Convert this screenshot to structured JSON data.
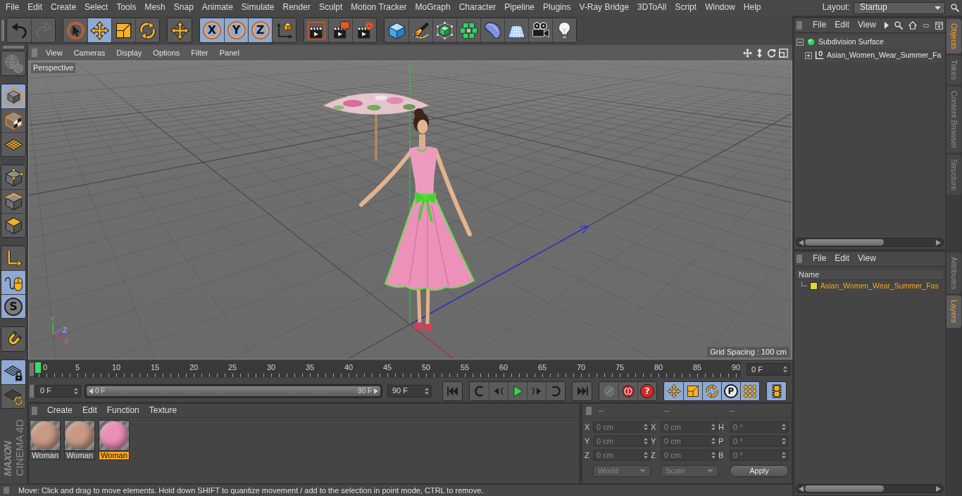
{
  "menu_bar": {
    "items": [
      "File",
      "Edit",
      "Create",
      "Select",
      "Tools",
      "Mesh",
      "Snap",
      "Animate",
      "Simulate",
      "Render",
      "Sculpt",
      "Motion Tracker",
      "MoGraph",
      "Character",
      "Pipeline",
      "Plugins",
      "V-Ray Bridge",
      "3DToAll",
      "Script",
      "Window",
      "Help"
    ],
    "layout_label": "Layout:",
    "layout_value": "Startup"
  },
  "toolbar": {
    "groups": [
      {
        "items": [
          {
            "kind": "undo",
            "selected": false,
            "disabled": false
          },
          {
            "kind": "redo",
            "selected": false,
            "disabled": true
          }
        ]
      },
      {
        "items": [
          {
            "kind": "select",
            "selected": false,
            "disabled": false
          },
          {
            "kind": "move",
            "selected": true,
            "disabled": false
          },
          {
            "kind": "scale",
            "selected": false,
            "disabled": false
          },
          {
            "kind": "rotate",
            "selected": false,
            "disabled": false
          }
        ]
      },
      {
        "items": [
          {
            "kind": "recent",
            "selected": false,
            "disabled": false
          }
        ]
      },
      {
        "items": [
          {
            "kind": "axis",
            "label": "X",
            "selected": true,
            "disabled": false
          },
          {
            "kind": "axis",
            "label": "Y",
            "selected": true,
            "disabled": false
          },
          {
            "kind": "axis",
            "label": "Z",
            "selected": true,
            "disabled": false
          },
          {
            "kind": "coords",
            "selected": false,
            "disabled": false
          }
        ]
      },
      {
        "items": [
          {
            "kind": "renderview",
            "selected": false,
            "disabled": false
          },
          {
            "kind": "renderpicture",
            "selected": false,
            "disabled": false
          },
          {
            "kind": "rendersettings",
            "selected": false,
            "disabled": false
          }
        ]
      },
      {
        "items": [
          {
            "kind": "cube",
            "selected": false,
            "disabled": false
          },
          {
            "kind": "pen",
            "selected": false,
            "disabled": false
          },
          {
            "kind": "subdivision",
            "selected": false,
            "disabled": false
          },
          {
            "kind": "cloner",
            "selected": false,
            "disabled": false
          },
          {
            "kind": "deformer",
            "selected": false,
            "disabled": false
          },
          {
            "kind": "floor",
            "selected": false,
            "disabled": false
          },
          {
            "kind": "camera",
            "selected": false,
            "disabled": false
          },
          {
            "kind": "light",
            "selected": false,
            "disabled": false
          }
        ]
      }
    ]
  },
  "left_toolbar": {
    "groups": [
      {
        "items": [
          {
            "kind": "editable",
            "selected": false,
            "disabled": true
          }
        ]
      },
      {
        "items": [
          {
            "kind": "model",
            "selected": true,
            "disabled": false
          },
          {
            "kind": "texture",
            "selected": false,
            "disabled": false
          },
          {
            "kind": "workplane",
            "selected": false,
            "disabled": false
          }
        ]
      },
      {
        "items": [
          {
            "kind": "points",
            "selected": false,
            "disabled": false
          },
          {
            "kind": "edges",
            "selected": false,
            "disabled": false
          },
          {
            "kind": "polygons",
            "selected": false,
            "disabled": false
          }
        ]
      },
      {
        "items": [
          {
            "kind": "axismode",
            "selected": false,
            "disabled": false
          },
          {
            "kind": "tweak",
            "selected": true,
            "disabled": false
          },
          {
            "kind": "solo",
            "label": "S",
            "selected": true,
            "disabled": false
          }
        ]
      },
      {
        "items": [
          {
            "kind": "snap",
            "selected": false,
            "disabled": false
          }
        ]
      },
      {
        "items": [
          {
            "kind": "lockplane",
            "selected": true,
            "disabled": false
          },
          {
            "kind": "planesnap",
            "selected": false,
            "disabled": false
          }
        ]
      }
    ]
  },
  "logo": {
    "brand": "MAXON",
    "product": "CINEMA 4D"
  },
  "viewport": {
    "menu": [
      "View",
      "Cameras",
      "Display",
      "Options",
      "Filter",
      "Panel"
    ],
    "camera": "Perspective",
    "grid_spacing": "Grid Spacing : 100 cm",
    "gizmo": {
      "y": "Y",
      "z": "Z",
      "x": "X"
    }
  },
  "timeline": {
    "ticks": [
      "0",
      "5",
      "10",
      "15",
      "20",
      "25",
      "30",
      "35",
      "40",
      "45",
      "50",
      "55",
      "60",
      "65",
      "70",
      "75",
      "80",
      "85",
      "90"
    ],
    "playhead": {
      "level": 0
    },
    "current_frame": "0 F"
  },
  "range": {
    "start": "0 F",
    "slider_start": "0 F",
    "slider_end": "90 F",
    "end": "90 F",
    "level": 1
  },
  "playback": {
    "groups": [
      {
        "items": [
          {
            "kind": "first",
            "selected": false,
            "disabled": false
          }
        ]
      },
      {
        "items": [
          {
            "kind": "prevkey",
            "selected": false,
            "disabled": false
          },
          {
            "kind": "prevframe",
            "selected": false,
            "disabled": false
          },
          {
            "kind": "play",
            "selected": false,
            "disabled": false
          },
          {
            "kind": "nextframe",
            "selected": false,
            "disabled": false
          },
          {
            "kind": "nextkey",
            "selected": false,
            "disabled": false
          }
        ]
      },
      {
        "items": [
          {
            "kind": "last",
            "selected": false,
            "disabled": false
          }
        ]
      },
      {
        "items": [
          {
            "kind": "record",
            "selected": false,
            "disabled": true
          },
          {
            "kind": "autokey",
            "selected": false,
            "disabled": false
          },
          {
            "kind": "keyhelp",
            "label": "?",
            "selected": false,
            "disabled": false
          }
        ]
      },
      {
        "items": [
          {
            "kind": "movekey",
            "selected": true,
            "disabled": false
          },
          {
            "kind": "scalekey",
            "selected": true,
            "disabled": false
          },
          {
            "kind": "rotatekey",
            "selected": true,
            "disabled": false
          },
          {
            "kind": "paramkey",
            "label": "P",
            "selected": true,
            "disabled": false
          },
          {
            "kind": "pointkey",
            "selected": true,
            "disabled": false
          }
        ]
      },
      {
        "items": [
          {
            "kind": "timelinewin",
            "selected": true,
            "disabled": false
          }
        ]
      }
    ]
  },
  "materials": {
    "menu": [
      "Create",
      "Edit",
      "Function",
      "Texture"
    ],
    "items": [
      {
        "name": "Woman",
        "color": "#c89a86",
        "selected": false
      },
      {
        "name": "Woman",
        "color": "#c89a86",
        "selected": false
      },
      {
        "name": "Woman",
        "color": "#e98fb8",
        "selected": true
      }
    ]
  },
  "coordinates": {
    "headers": [
      "--",
      "--",
      "--"
    ],
    "disabled": true,
    "rows": [
      {
        "position_label": "X",
        "position": "0 cm",
        "size_label": "X",
        "size": "0 cm",
        "rotation_label": "H",
        "rotation": "0 °"
      },
      {
        "position_label": "Y",
        "position": "0 cm",
        "size_label": "Y",
        "size": "0 cm",
        "rotation_label": "P",
        "rotation": "0 °"
      },
      {
        "position_label": "Z",
        "position": "0 cm",
        "size_label": "Z",
        "size": "0 cm",
        "rotation_label": "B",
        "rotation": "0 °"
      }
    ],
    "mode": "World",
    "transform": "Scale",
    "apply": "Apply"
  },
  "status_bar": {
    "text": "Move: Click and drag to move elements. Hold down SHIFT to quantize movement / add to the selection in point mode, CTRL to remove."
  },
  "object_manager": {
    "menu": [
      "File",
      "Edit",
      "View"
    ],
    "tree": [
      {
        "name": "Subdivision Surface",
        "kind": "subdivision",
        "expanded": true,
        "children": [
          {
            "name": "Asian_Women_Wear_Summer_Fa",
            "kind": "null",
            "expanded": false
          }
        ]
      }
    ]
  },
  "side_tabs_top": [
    {
      "label": "Objects",
      "selected": true
    },
    {
      "label": "Takes",
      "selected": false
    },
    {
      "label": "Content Browser",
      "selected": false
    },
    {
      "label": "Structure",
      "selected": false
    }
  ],
  "layer_manager": {
    "menu": [
      "File",
      "Edit",
      "View"
    ],
    "column": "Name",
    "layers": [
      {
        "name": "Asian_Women_Wear_Summer_Fas",
        "color": "#e6d52a",
        "selected": true
      }
    ]
  },
  "side_tabs_bottom": [
    {
      "label": "Attributes",
      "selected": false
    },
    {
      "label": "Layers",
      "selected": true
    }
  ]
}
